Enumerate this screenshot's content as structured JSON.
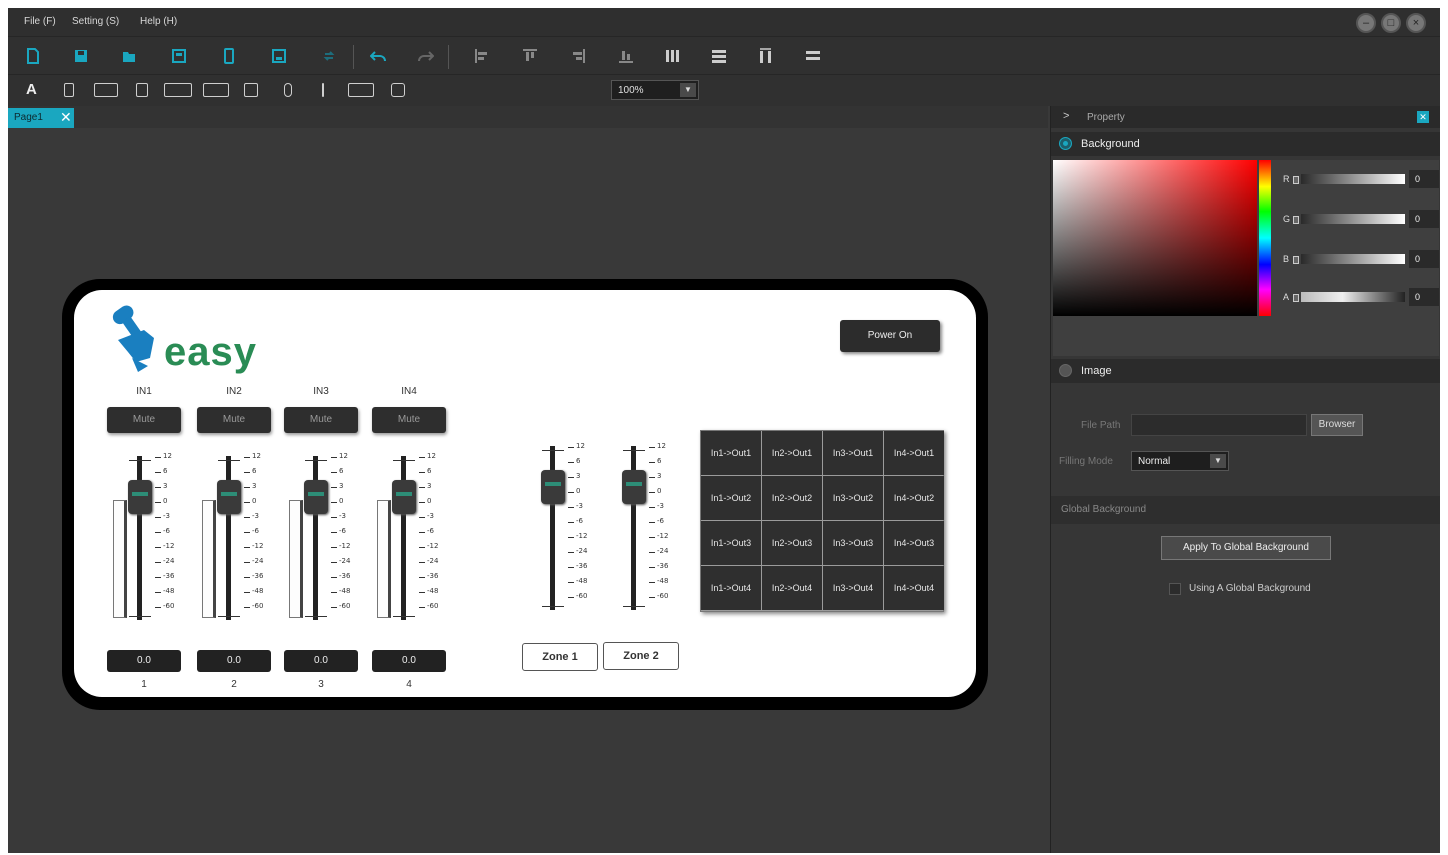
{
  "menubar": {
    "items": [
      "File (F)",
      "Setting (S)",
      "Help (H)"
    ]
  },
  "toolbar": {
    "zoom": "100%"
  },
  "tabs": [
    {
      "label": "Page1"
    }
  ],
  "device": {
    "logo_text": "easy",
    "power_button": "Power On",
    "channels": [
      {
        "label": "IN1",
        "mute": "Mute",
        "value": "0.0",
        "number": "1"
      },
      {
        "label": "IN2",
        "mute": "Mute",
        "value": "0.0",
        "number": "2"
      },
      {
        "label": "IN3",
        "mute": "Mute",
        "value": "0.0",
        "number": "3"
      },
      {
        "label": "IN4",
        "mute": "Mute",
        "value": "0.0",
        "number": "4"
      }
    ],
    "scale": [
      "12",
      "6",
      "3",
      "0",
      "-3",
      "-6",
      "-12",
      "-24",
      "-36",
      "-48",
      "-60"
    ],
    "zones": [
      "Zone 1",
      "Zone 2"
    ],
    "matrix": [
      [
        "In1->Out1",
        "In2->Out1",
        "In3->Out1",
        "In4->Out1"
      ],
      [
        "In1->Out2",
        "In2->Out2",
        "In3->Out2",
        "In4->Out2"
      ],
      [
        "In1->Out3",
        "In2->Out3",
        "In3->Out3",
        "In4->Out3"
      ],
      [
        "In1->Out4",
        "In2->Out4",
        "In3->Out4",
        "In4->Out4"
      ]
    ]
  },
  "property": {
    "title": "Property",
    "background_label": "Background",
    "channels": [
      {
        "label": "R",
        "value": "0"
      },
      {
        "label": "G",
        "value": "0"
      },
      {
        "label": "B",
        "value": "0"
      },
      {
        "label": "A",
        "value": "0"
      }
    ],
    "image_label": "Image",
    "file_path_label": "File Path",
    "file_path_value": "",
    "browse_button": "Browser",
    "filling_mode_label": "Filling Mode",
    "filling_mode_value": "Normal",
    "global_background_header": "Global Background",
    "apply_button": "Apply To Global Background",
    "using_global_label": "Using A Global Background"
  },
  "colors": {
    "accent": "#1aa7c0",
    "logo_green": "#2a8c55",
    "logo_blue": "#1a7fc0"
  }
}
